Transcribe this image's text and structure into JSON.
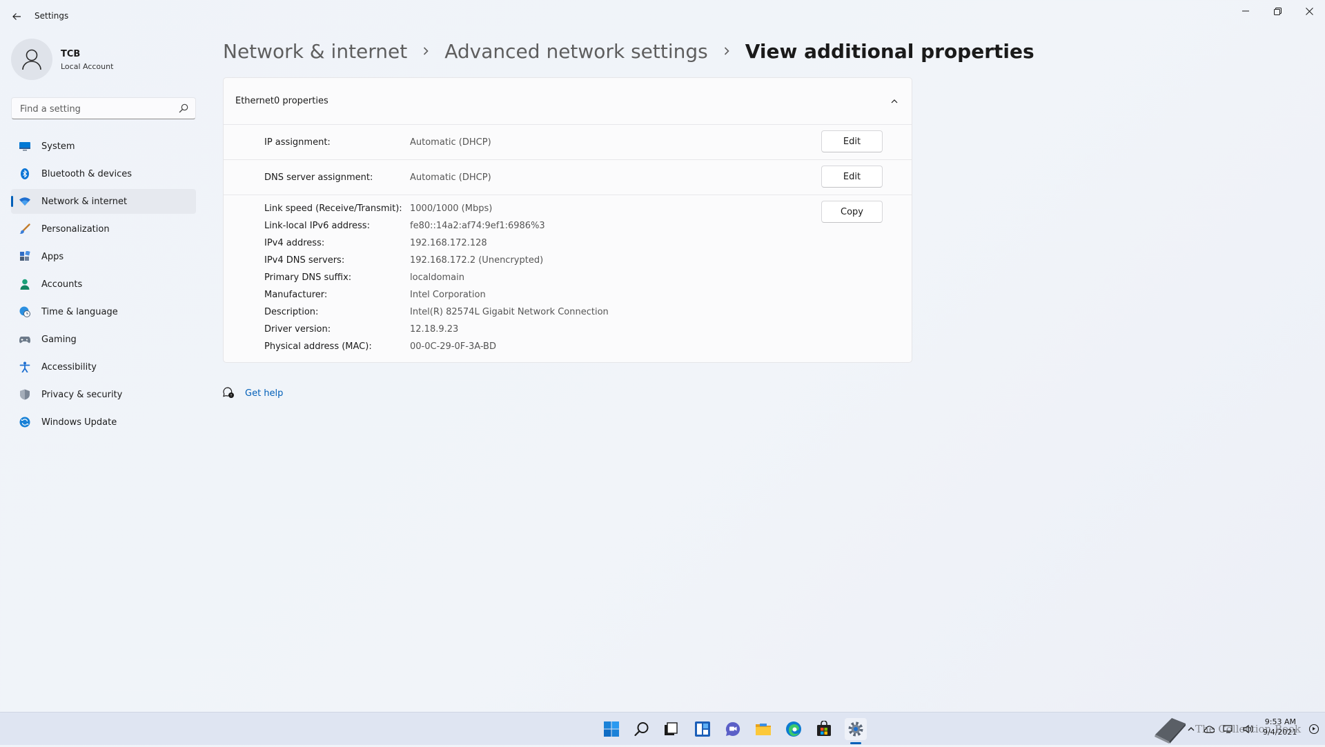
{
  "window": {
    "title": "Settings"
  },
  "user": {
    "name": "TCB",
    "account_type": "Local Account"
  },
  "search": {
    "placeholder": "Find a setting"
  },
  "sidebar": {
    "items": [
      {
        "label": "System",
        "icon": "monitor-icon"
      },
      {
        "label": "Bluetooth & devices",
        "icon": "bluetooth-icon"
      },
      {
        "label": "Network & internet",
        "icon": "wifi-icon",
        "active": true
      },
      {
        "label": "Personalization",
        "icon": "brush-icon"
      },
      {
        "label": "Apps",
        "icon": "apps-icon"
      },
      {
        "label": "Accounts",
        "icon": "person-icon"
      },
      {
        "label": "Time & language",
        "icon": "globe-clock-icon"
      },
      {
        "label": "Gaming",
        "icon": "gamepad-icon"
      },
      {
        "label": "Accessibility",
        "icon": "accessibility-icon"
      },
      {
        "label": "Privacy & security",
        "icon": "shield-icon"
      },
      {
        "label": "Windows Update",
        "icon": "update-icon"
      }
    ]
  },
  "breadcrumb": {
    "items": [
      "Network & internet",
      "Advanced network settings"
    ],
    "current": "View additional properties"
  },
  "card": {
    "title": "Ethernet0 properties",
    "ip_assignment": {
      "label": "IP assignment:",
      "value": "Automatic (DHCP)",
      "button": "Edit"
    },
    "dns_assignment": {
      "label": "DNS server assignment:",
      "value": "Automatic (DHCP)",
      "button": "Edit"
    },
    "copy_button": "Copy",
    "properties": [
      {
        "label": "Link speed (Receive/Transmit):",
        "value": "1000/1000 (Mbps)"
      },
      {
        "label": "Link-local IPv6 address:",
        "value": "fe80::14a2:af74:9ef1:6986%3"
      },
      {
        "label": "IPv4 address:",
        "value": "192.168.172.128"
      },
      {
        "label": "IPv4 DNS servers:",
        "value": "192.168.172.2 (Unencrypted)"
      },
      {
        "label": "Primary DNS suffix:",
        "value": "localdomain"
      },
      {
        "label": "Manufacturer:",
        "value": "Intel Corporation"
      },
      {
        "label": "Description:",
        "value": "Intel(R) 82574L Gigabit Network Connection"
      },
      {
        "label": "Driver version:",
        "value": "12.18.9.23"
      },
      {
        "label": "Physical address (MAC):",
        "value": "00-0C-29-0F-3A-BD"
      }
    ]
  },
  "help": {
    "label": "Get help"
  },
  "taskbar": {
    "apps": [
      "start-icon",
      "search-icon",
      "task-view-icon",
      "widgets-icon",
      "chat-icon",
      "file-explorer-icon",
      "edge-icon",
      "store-icon",
      "settings-icon"
    ],
    "time": "9:53 AM",
    "date": "9/4/2021",
    "watermark": "The Collection Book"
  },
  "colors": {
    "accent": "#005fb8",
    "background": "#f0f3f9",
    "card": "#fbfbfc"
  }
}
